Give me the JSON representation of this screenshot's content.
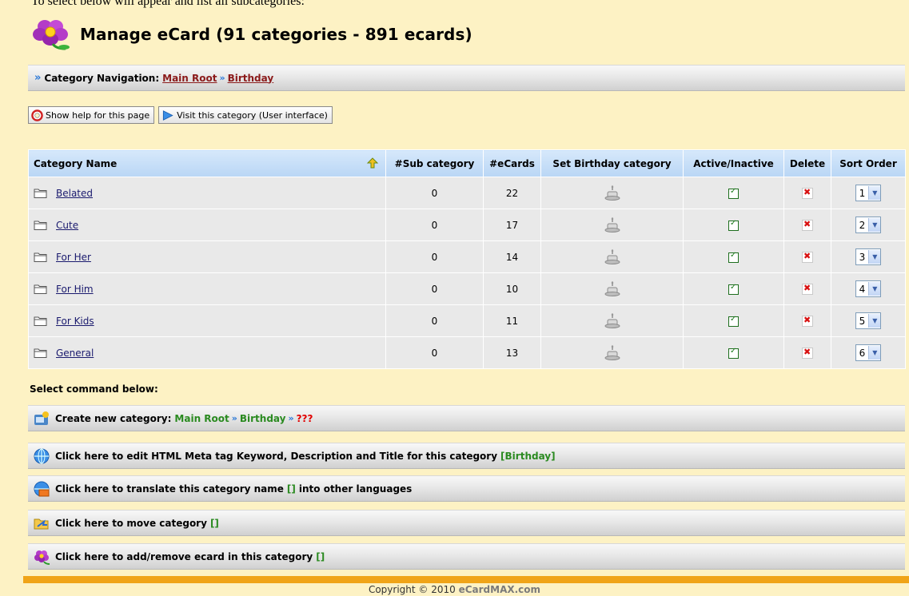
{
  "top_cut_text": "To select below will appear and list all subcategories:",
  "page": {
    "title": "Manage eCard (91 categories - 891 ecards)"
  },
  "navigation": {
    "label": "Category Navigation:",
    "crumbs": [
      "Main Root",
      "Birthday"
    ]
  },
  "buttons": {
    "help": "Show help for this page",
    "visit": "Visit this category (User interface)"
  },
  "table": {
    "headers": {
      "category_name": "Category Name",
      "sub_category": "#Sub category",
      "ecards": "#eCards",
      "set_birthday": "Set Birthday category",
      "active": "Active/Inactive",
      "delete": "Delete",
      "sort_order": "Sort Order"
    },
    "rows": [
      {
        "name": "Belated",
        "sub": "0",
        "ecards": "22",
        "sort": "1"
      },
      {
        "name": "Cute",
        "sub": "0",
        "ecards": "17",
        "sort": "2"
      },
      {
        "name": "For Her",
        "sub": "0",
        "ecards": "14",
        "sort": "3"
      },
      {
        "name": "For Him",
        "sub": "0",
        "ecards": "10",
        "sort": "4"
      },
      {
        "name": "For Kids",
        "sub": "0",
        "ecards": "11",
        "sort": "5"
      },
      {
        "name": "General",
        "sub": "0",
        "ecards": "13",
        "sort": "6"
      }
    ]
  },
  "commands": {
    "heading": "Select command below:",
    "create": {
      "label": "Create new category:",
      "path": [
        "Main Root",
        "Birthday",
        "???"
      ]
    },
    "meta": {
      "label": "Click here to edit HTML Meta tag Keyword, Description and Title for this category",
      "target": "[Birthday]"
    },
    "translate": {
      "label_before": "Click here to translate this category name",
      "target": "[]",
      "label_after": "into other languages"
    },
    "move": {
      "label": "Click here to move category",
      "target": "[]"
    },
    "ecards": {
      "label": "Click here to add/remove ecard in this category",
      "target": "[]"
    }
  },
  "footer": {
    "text": "Copyright © 2010",
    "brand": "eCardMAX.com"
  }
}
